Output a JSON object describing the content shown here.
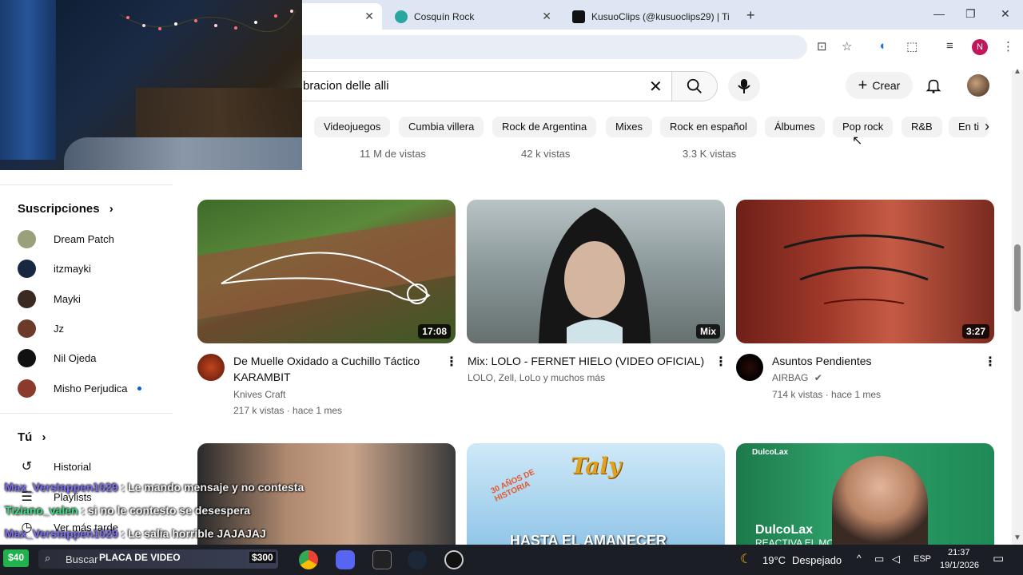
{
  "browser": {
    "tabs": [
      {
        "title": "",
        "active": true
      },
      {
        "title": "Cosquín Rock",
        "active": false
      },
      {
        "title": "KusuoClips (@kusuoclips29) | Ti",
        "active": false
      }
    ],
    "new_tab": "+",
    "profile_initial": "N"
  },
  "youtube": {
    "search_query": "bracion delle alli",
    "create_label": "Crear",
    "chips": [
      "Videojuegos",
      "Cumbia villera",
      "Rock de Argentina",
      "Mixes",
      "Rock en español",
      "Álbumes",
      "Pop rock",
      "R&B",
      "En ti"
    ],
    "previous_row_views": [
      "11 M de vistas",
      "42 k vistas",
      "3.3 K vistas"
    ]
  },
  "sidebar": {
    "subscriptions_title": "Suscripciones",
    "subscriptions": [
      {
        "name": "Dream Patch",
        "color": "#9aa07a"
      },
      {
        "name": "itzmayki",
        "color": "#1a2740"
      },
      {
        "name": "Mayki",
        "color": "#3a2a22"
      },
      {
        "name": "Jz",
        "color": "#6b3a2a"
      },
      {
        "name": "Nil Ojeda",
        "color": "#111111"
      },
      {
        "name": "Misho Perjudica",
        "color": "#8a3b2b",
        "new": true
      }
    ],
    "you_title": "Tú",
    "you_items": [
      {
        "label": "Historial",
        "icon": "history-icon"
      },
      {
        "label": "Playlists",
        "icon": "playlist-icon"
      },
      {
        "label": "Ver más tarde",
        "icon": "clock-icon"
      }
    ]
  },
  "videos": [
    {
      "title": "De Muelle Oxidado a Cuchillo Táctico KARAMBIT",
      "channel": "Knives Craft",
      "meta": "217 k vistas · hace 1 mes",
      "duration": "17:08"
    },
    {
      "title": "Mix: LOLO - FERNET HIELO (VIDEO OFICIAL)",
      "channel": "LOLO, Zell, LoLo y muchos más",
      "meta": "",
      "duration": "Mix"
    },
    {
      "title": "Asuntos Pendientes",
      "channel": "AIRBAG",
      "meta": "714 k vistas · hace 1 mes",
      "duration": "3:27"
    }
  ],
  "bottom_row_overlays": {
    "thumb2_text": "HASTA EL AMANECER",
    "thumb2_brand": "Taly",
    "thumb2_years": "30 AÑOS DE HISTORIA",
    "thumb3_brand_top": "DulcoLax",
    "thumb3_brand": "DulcoLax",
    "thumb3_text": "REACTIVA EL MOVIMIENTO"
  },
  "chat": [
    {
      "user": "Max_Verstappen1029",
      "message": ": Le mando mensaje y no contesta"
    },
    {
      "user": "Tiziano_valen",
      "message": ": si no le contesto se desespera"
    },
    {
      "user": "Max_Verstappen1029",
      "message": ": Le salia horrible JAJAJAJ"
    }
  ],
  "stream_overlay": {
    "donation_left": "$40",
    "search_label": "Buscar",
    "goal_label": "PLACA DE VIDEO",
    "donation_right": "$300"
  },
  "taskbar": {
    "weather_temp": "19°C",
    "weather_desc": "Despejado",
    "lang": "ESP",
    "time": "21:37",
    "date": "19/1/2026"
  },
  "colors": {
    "accent": "#065fd4",
    "chat_user": "#7b6cf0",
    "chat_user_alt": "#3ddc84",
    "donation_green": "#22b14c"
  }
}
